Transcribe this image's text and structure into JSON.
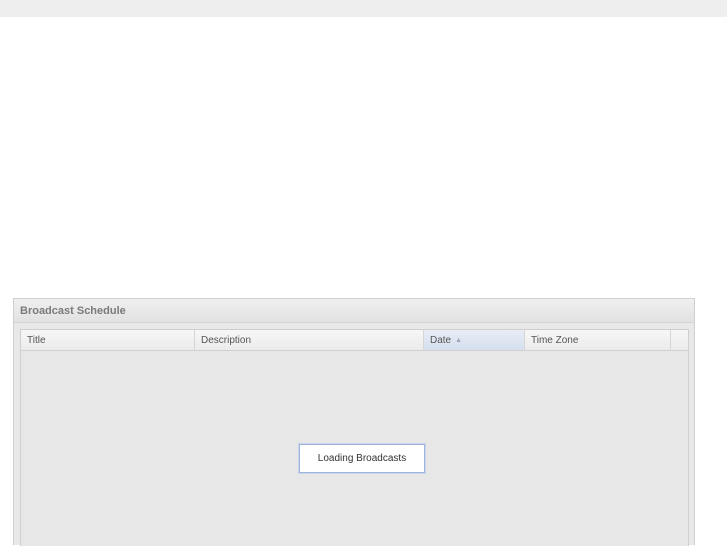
{
  "panel": {
    "title": "Broadcast Schedule"
  },
  "grid": {
    "columns": [
      {
        "label": "Title"
      },
      {
        "label": "Description"
      },
      {
        "label": "Date",
        "sort_indicator": "▲"
      },
      {
        "label": "Time Zone"
      }
    ]
  },
  "loading": {
    "message": "Loading Broadcasts"
  }
}
